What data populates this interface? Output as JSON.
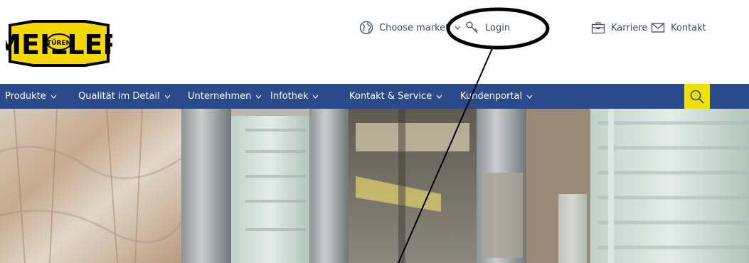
{
  "header": {
    "logo_text": "MEILLER",
    "logo_badge": "TÜREN",
    "choose_market": "Choose market",
    "login": "Login",
    "karriere": "Karriere",
    "kontakt": "Kontakt"
  },
  "nav": {
    "items": [
      {
        "label": "Produkte"
      },
      {
        "label": "Qualität im Detail"
      },
      {
        "label": "Unternehmen"
      },
      {
        "label": "Infothek"
      },
      {
        "label": "Kontakt & Service"
      },
      {
        "label": "Kundenportal"
      }
    ]
  },
  "colors": {
    "nav_bg": "#2b4a8a",
    "accent_yellow": "#f0e000",
    "utility_text": "#3d4a6b"
  },
  "icons": {
    "market": "globe-icon",
    "login": "key-icon",
    "karriere": "briefcase-icon",
    "kontakt": "mail-icon",
    "search": "search-icon",
    "nav_chevron": "chevron-down-icon"
  }
}
